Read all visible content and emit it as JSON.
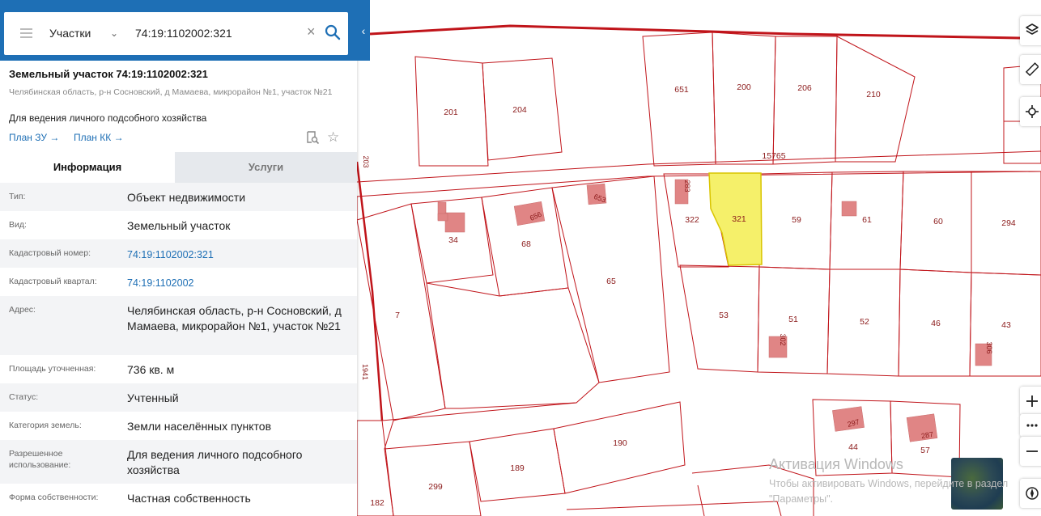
{
  "search": {
    "layer": "Участки",
    "query": "74:19:1102002:321"
  },
  "parcel": {
    "title": "Земельный участок 74:19:1102002:321",
    "address": "Челябинская область, р-н Сосновский, д Мамаева, микрорайон №1, участок №21",
    "purpose": "Для ведения личного подсобного хозяйства",
    "link_zu": "План ЗУ →",
    "link_kk": "План КК →"
  },
  "tabs": {
    "info": "Информация",
    "services": "Услуги"
  },
  "rows": [
    {
      "key": "Тип:",
      "value": "Объект недвижимости"
    },
    {
      "key": "Вид:",
      "value": "Земельный участок"
    },
    {
      "key": "Кадастровый номер:",
      "value": "74:19:1102002:321"
    },
    {
      "key": "Кадастровый квартал:",
      "value": "74:19:1102002"
    },
    {
      "key": "Адрес:",
      "value": "Челябинская область, р-н Сосновский, д Мамаева, микрорайон №1, участок №21"
    },
    {
      "key": "Площадь уточненная:",
      "value": "736 кв. м"
    },
    {
      "key": "Статус:",
      "value": "Учтенный"
    },
    {
      "key": "Категория земель:",
      "value": "Земли населённых пунктов"
    },
    {
      "key": "Разрешенное использование:",
      "value": "Для ведения личного подсобного хозяйства"
    },
    {
      "key": "Форма собственности:",
      "value": "Частная собственность"
    }
  ],
  "map": {
    "labels": [
      "201",
      "204",
      "651",
      "200",
      "206",
      "210",
      "15765",
      "203",
      "283",
      "322",
      "321",
      "59",
      "61",
      "60",
      "294",
      "34",
      "656",
      "68",
      "653",
      "65",
      "7",
      "53",
      "51",
      "302",
      "52",
      "46",
      "43",
      "306",
      "1941",
      "297",
      "44",
      "287",
      "57",
      "190",
      "189",
      "299",
      "182"
    ]
  },
  "colors": {
    "brand_blue": "#1e6fb5",
    "boundary": "#c0141a",
    "selected_fill": "#f5f06a",
    "building": "#e08585"
  },
  "watermark": {
    "line1": "Активация Windows",
    "line2": "Чтобы активировать Windows, перейдите в раздел \"Параметры\"."
  }
}
